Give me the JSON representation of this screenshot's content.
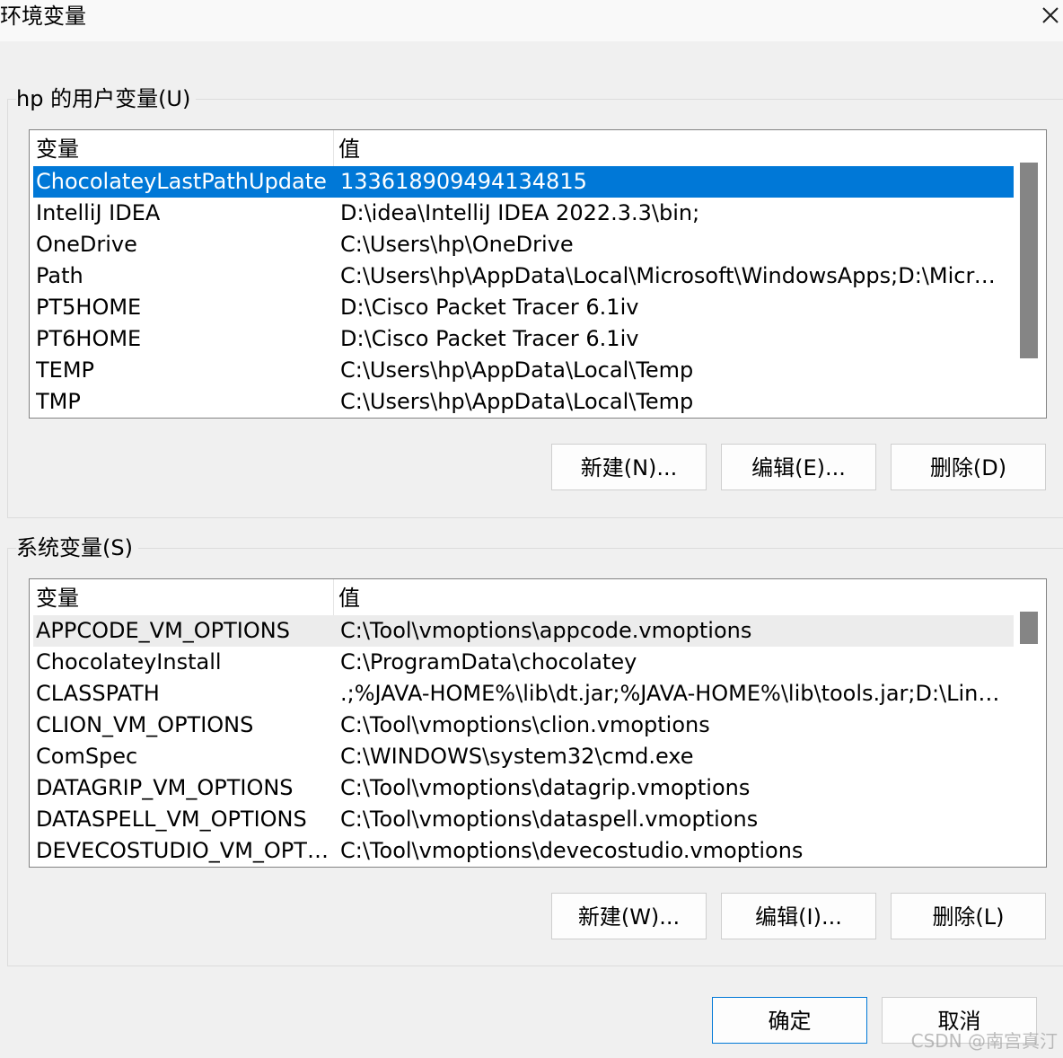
{
  "window": {
    "title": "环境变量"
  },
  "user_vars": {
    "group_label": "hp 的用户变量(U)",
    "headers": {
      "name": "变量",
      "value": "值"
    },
    "rows": [
      {
        "name": "ChocolateyLastPathUpdate",
        "value": "133618909494134815"
      },
      {
        "name": "IntelliJ IDEA",
        "value": "D:\\idea\\IntelliJ IDEA 2022.3.3\\bin;"
      },
      {
        "name": "OneDrive",
        "value": "C:\\Users\\hp\\OneDrive"
      },
      {
        "name": "Path",
        "value": "C:\\Users\\hp\\AppData\\Local\\Microsoft\\WindowsApps;D:\\Micros..."
      },
      {
        "name": "PT5HOME",
        "value": "D:\\Cisco Packet Tracer 6.1iv"
      },
      {
        "name": "PT6HOME",
        "value": "D:\\Cisco Packet Tracer 6.1iv"
      },
      {
        "name": "TEMP",
        "value": "C:\\Users\\hp\\AppData\\Local\\Temp"
      },
      {
        "name": "TMP",
        "value": "C:\\Users\\hp\\AppData\\Local\\Temp"
      }
    ],
    "buttons": {
      "new": "新建(N)...",
      "edit": "编辑(E)...",
      "delete": "删除(D)"
    }
  },
  "system_vars": {
    "group_label": "系统变量(S)",
    "headers": {
      "name": "变量",
      "value": "值"
    },
    "rows": [
      {
        "name": "APPCODE_VM_OPTIONS",
        "value": "C:\\Tool\\vmoptions\\appcode.vmoptions"
      },
      {
        "name": "ChocolateyInstall",
        "value": "C:\\ProgramData\\chocolatey"
      },
      {
        "name": "CLASSPATH",
        "value": ".;%JAVA-HOME%\\lib\\dt.jar;%JAVA-HOME%\\lib\\tools.jar;D:\\Ling..."
      },
      {
        "name": "CLION_VM_OPTIONS",
        "value": "C:\\Tool\\vmoptions\\clion.vmoptions"
      },
      {
        "name": "ComSpec",
        "value": "C:\\WINDOWS\\system32\\cmd.exe"
      },
      {
        "name": "DATAGRIP_VM_OPTIONS",
        "value": "C:\\Tool\\vmoptions\\datagrip.vmoptions"
      },
      {
        "name": "DATASPELL_VM_OPTIONS",
        "value": "C:\\Tool\\vmoptions\\dataspell.vmoptions"
      },
      {
        "name": "DEVECOSTUDIO_VM_OPTI...",
        "value": "C:\\Tool\\vmoptions\\devecostudio.vmoptions"
      }
    ],
    "buttons": {
      "new": "新建(W)...",
      "edit": "编辑(I)...",
      "delete": "删除(L)"
    }
  },
  "footer": {
    "ok": "确定",
    "cancel": "取消"
  },
  "watermark": "CSDN @南宫真汀",
  "colors": {
    "selection": "#0078d7",
    "background": "#f0f0f0"
  }
}
